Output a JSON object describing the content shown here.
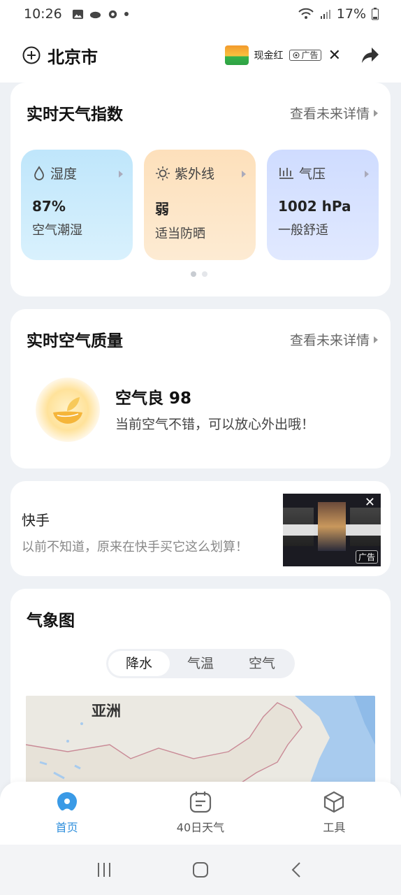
{
  "status_bar": {
    "time": "10:26",
    "battery": "17%"
  },
  "header": {
    "city": "北京市",
    "ad_label": "现金红",
    "ad_tag": "广告"
  },
  "weather_index": {
    "title": "实时天气指数",
    "link": "查看未来详情",
    "tiles": [
      {
        "name": "湿度",
        "value": "87%",
        "desc": "空气潮湿",
        "icon": "droplet-icon"
      },
      {
        "name": "紫外线",
        "value": "弱",
        "desc": "适当防晒",
        "icon": "sun-icon"
      },
      {
        "name": "气压",
        "value": "1002 hPa",
        "desc": "一般舒适",
        "icon": "pressure-icon"
      }
    ],
    "page_count": 2,
    "active_page": 1
  },
  "air_quality": {
    "title": "实时空气质量",
    "link": "查看未来详情",
    "status": "空气良 98",
    "message": "当前空气不错，可以放心外出哦！",
    "icon": "leaf-icon"
  },
  "ad_card": {
    "title": "快手",
    "description": "以前不知道，原来在快手买它这么划算！",
    "tag": "广告"
  },
  "weather_map": {
    "title": "气象图",
    "tabs": [
      "降水",
      "气温",
      "空气"
    ],
    "active_tab": "降水",
    "map_label": "亚洲"
  },
  "bottom_nav": {
    "items": [
      {
        "label": "首页",
        "icon": "home-blob-icon",
        "active": true
      },
      {
        "label": "40日天气",
        "icon": "calendar-icon",
        "active": false
      },
      {
        "label": "工具",
        "icon": "cube-icon",
        "active": false
      }
    ]
  },
  "colors": {
    "accent": "#2f8fdc",
    "humid_tile": "#bfe6fb",
    "uv_tile": "#fde0bb",
    "pressure_tile": "#cfdcff"
  }
}
